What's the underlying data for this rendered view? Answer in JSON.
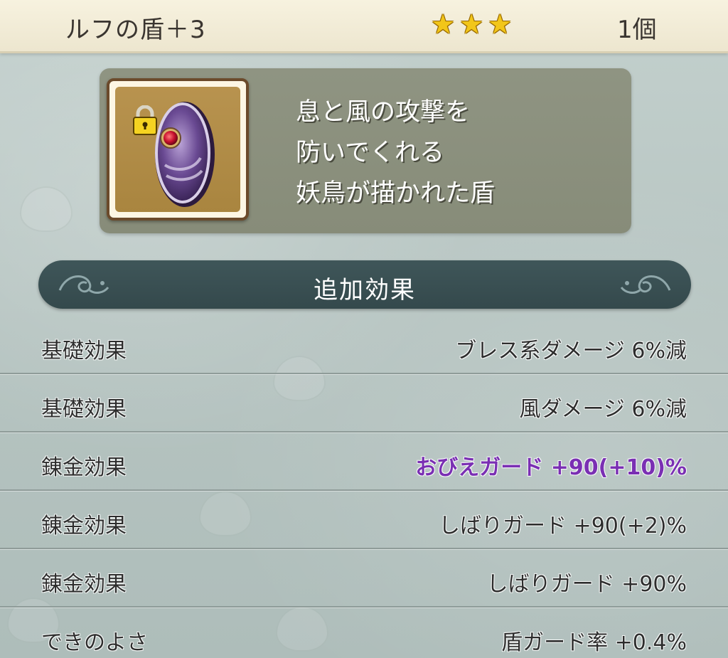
{
  "header": {
    "item_name": "ルフの盾＋3",
    "stars": [
      "★",
      "★",
      "★"
    ],
    "count": "1個"
  },
  "item": {
    "icon": "shield-icon",
    "locked_icon": "lock-icon",
    "description_lines": [
      "息と風の攻撃を",
      "防いでくれる",
      "妖鳥が描かれた盾"
    ]
  },
  "section": {
    "title": "追加効果"
  },
  "effects": [
    {
      "label": "基礎効果",
      "value": "ブレス系ダメージ  6%減",
      "highlight": false
    },
    {
      "label": "基礎効果",
      "value": "風ダメージ  6%減",
      "highlight": false
    },
    {
      "label": "錬金効果",
      "value": "おびえガード  +90(+10)%",
      "highlight": true
    },
    {
      "label": "錬金効果",
      "value": "しばりガード  +90(+2)%",
      "highlight": false
    },
    {
      "label": "錬金効果",
      "value": "しばりガード  +90%",
      "highlight": false
    },
    {
      "label": "できのよさ",
      "value": "盾ガード率  +0.4%",
      "highlight": false
    }
  ],
  "colors": {
    "highlight": "#7a2fb3",
    "star": "#f2c619",
    "banner": "#3f5659"
  }
}
